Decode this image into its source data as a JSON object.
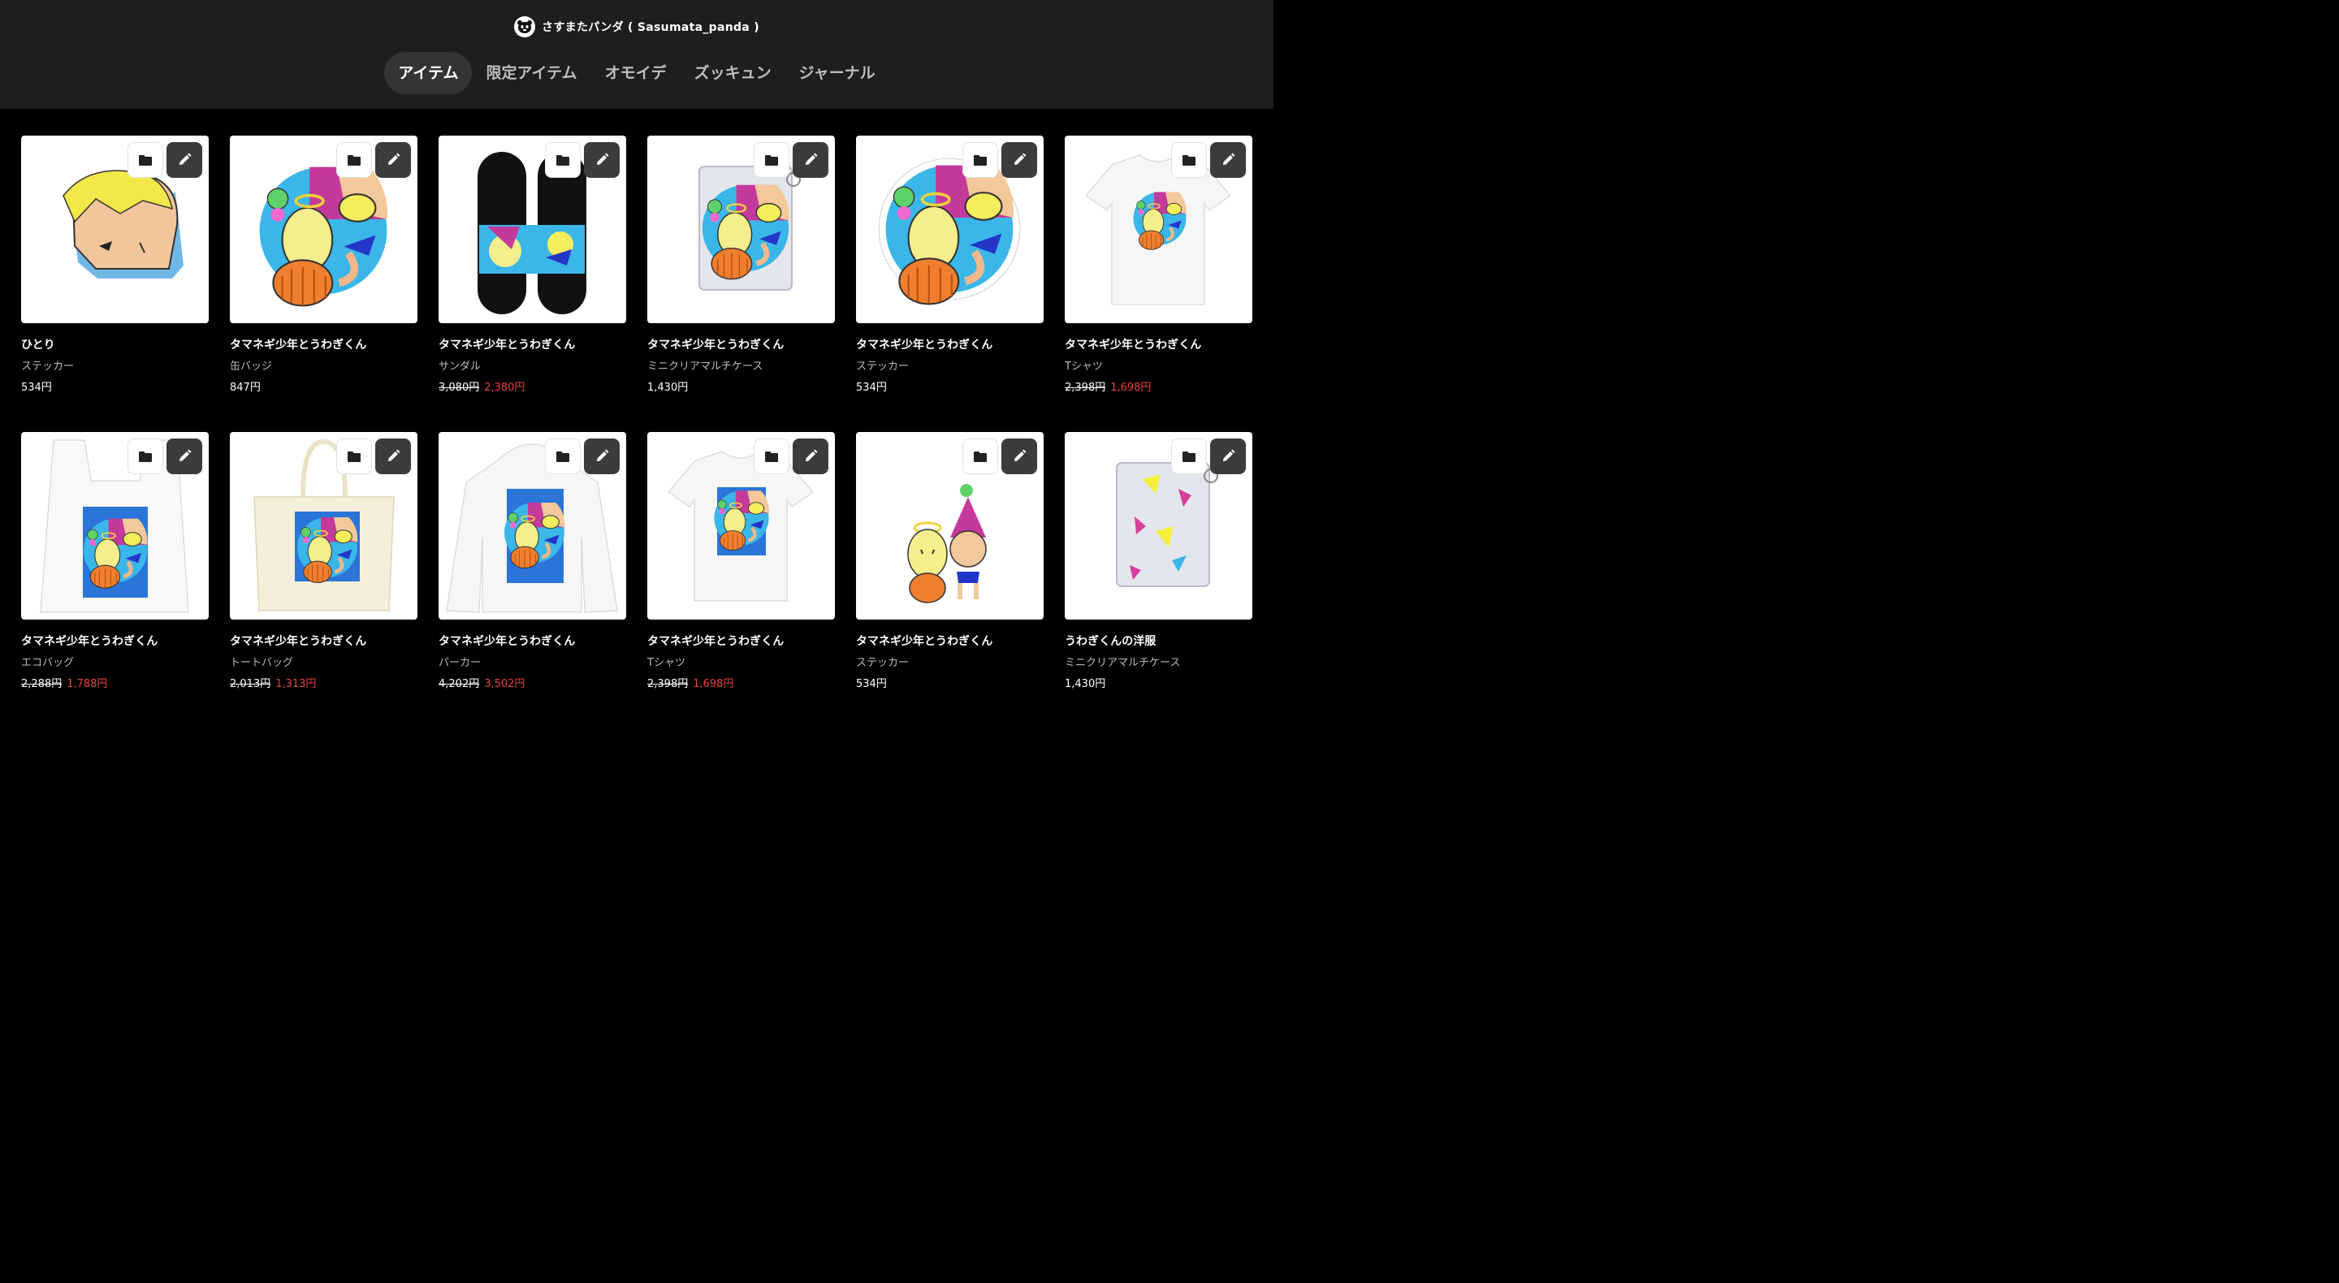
{
  "shop": {
    "name": "さすまたパンダ ( Sasumata_panda )",
    "logo_icon": "panda-icon"
  },
  "tabs": [
    {
      "label": "アイテム",
      "active": true
    },
    {
      "label": "限定アイテム",
      "active": false
    },
    {
      "label": "オモイデ",
      "active": false
    },
    {
      "label": "ズッキュン",
      "active": false
    },
    {
      "label": "ジャーナル",
      "active": false
    }
  ],
  "icons": {
    "folder": "folder-icon",
    "edit": "pencil-icon"
  },
  "colors": {
    "header_bg": "#1e1e1f",
    "page_bg": "#000000",
    "sale_price": "#e5443c",
    "active_tab_bg": "#343436"
  },
  "items": [
    {
      "title": "ひとり",
      "type": "ステッカー",
      "original_price": "",
      "price": "534円",
      "art": "head-sticker"
    },
    {
      "title": "タマネギ少年とうわぎくん",
      "type": "缶バッジ",
      "original_price": "",
      "price": "847円",
      "art": "badge"
    },
    {
      "title": "タマネギ少年とうわぎくん",
      "type": "サンダル",
      "original_price": "3,080円",
      "price": "2,380円",
      "art": "sandals"
    },
    {
      "title": "タマネギ少年とうわぎくん",
      "type": "ミニクリアマルチケース",
      "original_price": "",
      "price": "1,430円",
      "art": "clear-case"
    },
    {
      "title": "タマネギ少年とうわぎくん",
      "type": "ステッカー",
      "original_price": "",
      "price": "534円",
      "art": "die-sticker"
    },
    {
      "title": "タマネギ少年とうわぎくん",
      "type": "Tシャツ",
      "original_price": "2,398円",
      "price": "1,698円",
      "art": "tshirt-plain"
    },
    {
      "title": "タマネギ少年とうわぎくん",
      "type": "エコバッグ",
      "original_price": "2,288円",
      "price": "1,788円",
      "art": "eco-bag"
    },
    {
      "title": "タマネギ少年とうわぎくん",
      "type": "トートバッグ",
      "original_price": "2,013円",
      "price": "1,313円",
      "art": "tote"
    },
    {
      "title": "タマネギ少年とうわぎくん",
      "type": "パーカー",
      "original_price": "4,202円",
      "price": "3,502円",
      "art": "hoodie"
    },
    {
      "title": "タマネギ少年とうわぎくん",
      "type": "Tシャツ",
      "original_price": "2,398円",
      "price": "1,698円",
      "art": "tshirt-print"
    },
    {
      "title": "タマネギ少年とうわぎくん",
      "type": "ステッカー",
      "original_price": "",
      "price": "534円",
      "art": "characters-sticker"
    },
    {
      "title": "うわぎくんの洋服",
      "type": "ミニクリアマルチケース",
      "original_price": "",
      "price": "1,430円",
      "art": "clear-case-clothes"
    }
  ]
}
